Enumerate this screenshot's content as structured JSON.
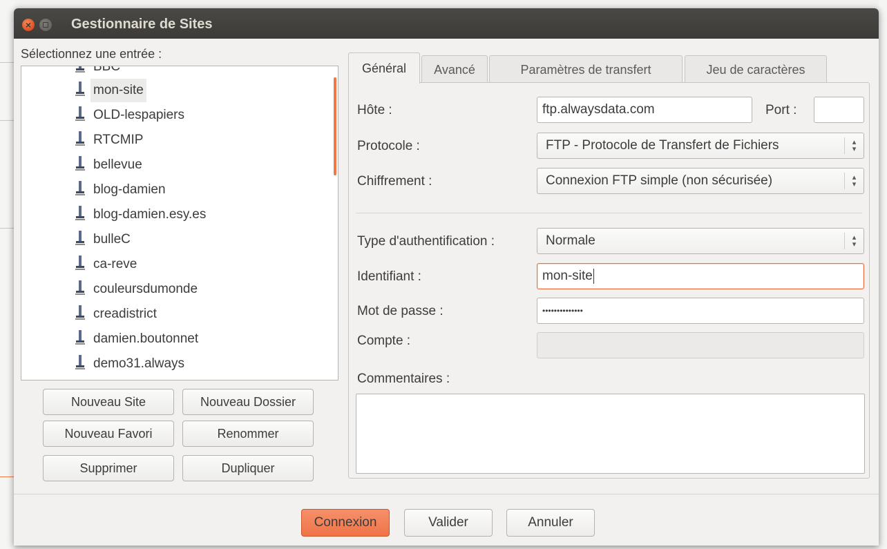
{
  "dialog": {
    "title": "Gestionnaire de Sites",
    "close_icon": "close-icon",
    "minimize_icon": "minimize-icon"
  },
  "sites": {
    "label": "Sélectionnez une entrée :",
    "items": [
      {
        "label": "BBC",
        "icon": "server-icon"
      },
      {
        "label": "mon-site",
        "icon": "server-icon",
        "selected": true
      },
      {
        "label": "OLD-lespapiers",
        "icon": "server-icon"
      },
      {
        "label": "RTCMIP",
        "icon": "server-icon"
      },
      {
        "label": "bellevue",
        "icon": "server-icon"
      },
      {
        "label": "blog-damien",
        "icon": "server-icon"
      },
      {
        "label": "blog-damien.esy.es",
        "icon": "server-icon"
      },
      {
        "label": "bulleC",
        "icon": "server-icon"
      },
      {
        "label": "ca-reve",
        "icon": "server-icon"
      },
      {
        "label": "couleursdumonde",
        "icon": "server-icon"
      },
      {
        "label": "creadistrict",
        "icon": "server-icon"
      },
      {
        "label": "damien.boutonnet",
        "icon": "server-icon"
      },
      {
        "label": "demo31.always",
        "icon": "server-icon"
      }
    ],
    "buttons": {
      "new_site": "Nouveau Site",
      "new_folder": "Nouveau Dossier",
      "new_bookmark": "Nouveau Favori",
      "rename": "Renommer",
      "delete": "Supprimer",
      "duplicate": "Dupliquer"
    }
  },
  "tabs": [
    {
      "label": "Général",
      "active": true
    },
    {
      "label": "Avancé"
    },
    {
      "label": "Paramètres de transfert"
    },
    {
      "label": "Jeu de caractères"
    }
  ],
  "general": {
    "host_label": "Hôte :",
    "host_value": "ftp.alwaysdata.com",
    "port_label": "Port :",
    "port_value": "",
    "protocol_label": "Protocole :",
    "protocol_value": "FTP - Protocole de Transfert de Fichiers",
    "encryption_label": "Chiffrement :",
    "encryption_value": "Connexion FTP simple (non sécurisée)",
    "auth_type_label": "Type d'authentification :",
    "auth_type_value": "Normale",
    "user_label": "Identifiant :",
    "user_value": "mon-site",
    "password_label": "Mot de passe :",
    "password_value": "••••••••••••••",
    "account_label": "Compte :",
    "account_value": "",
    "comments_label": "Commentaires :",
    "comments_value": ""
  },
  "footer": {
    "connect": "Connexion",
    "ok": "Valider",
    "cancel": "Annuler"
  },
  "colors": {
    "accent": "#f07746",
    "titlebar": "#3c3b37"
  }
}
